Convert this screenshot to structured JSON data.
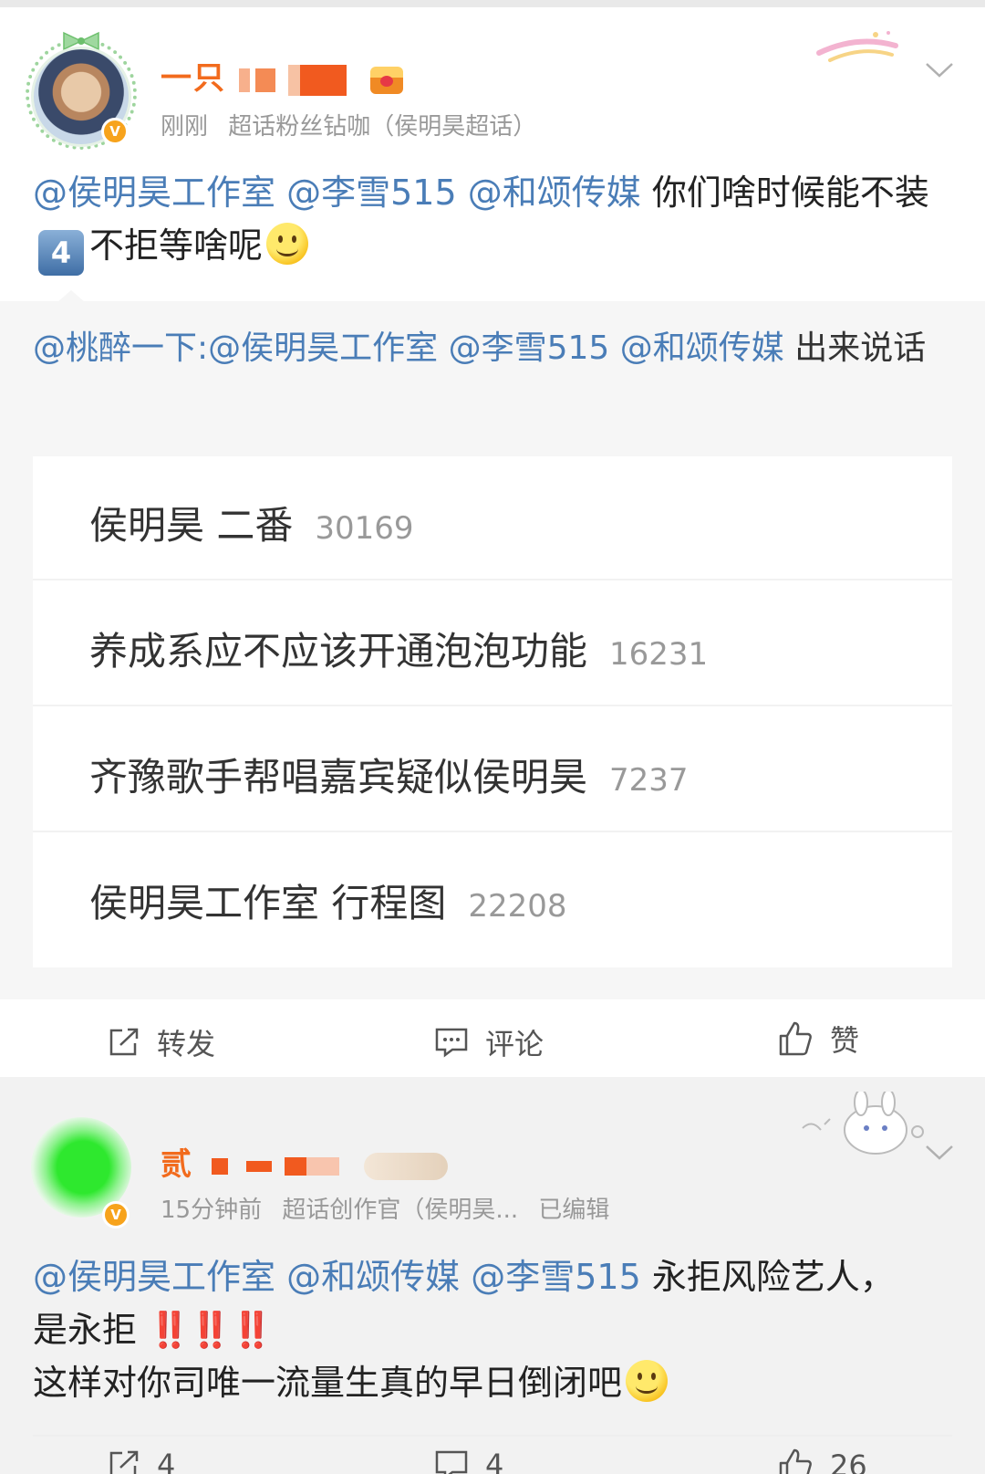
{
  "post1": {
    "username": "一只",
    "time": "刚刚",
    "source": "超话粉丝钻咖（侯明昊超话）",
    "mentions": [
      "@侯明昊工作室",
      "@李雪515",
      "@和颂传媒"
    ],
    "text_part1": "你们啥时候能不装",
    "keycap": "4",
    "text_part2": "不拒等啥呢",
    "retweet": {
      "author": "@桃醉一下:",
      "mentions": [
        "@侯明昊工作室",
        "@李雪515",
        "@和颂传媒"
      ],
      "text": "出来说话"
    },
    "topics": [
      {
        "title": "侯明昊 二番",
        "count": "30169"
      },
      {
        "title": "养成系应不应该开通泡泡功能",
        "count": "16231"
      },
      {
        "title": "齐豫歌手帮唱嘉宾疑似侯明昊",
        "count": "7237"
      },
      {
        "title": "侯明昊工作室 行程图",
        "count": "22208"
      }
    ],
    "actions": {
      "repost": "转发",
      "comment": "评论",
      "like": "赞"
    }
  },
  "post2": {
    "username": "贰",
    "time": "15分钟前",
    "source": "超话创作官（侯明昊...",
    "edited": "已编辑",
    "mentions": [
      "@侯明昊工作室",
      "@和颂传媒",
      "@李雪515"
    ],
    "text_part1": "永拒风险艺人，",
    "text_part2": "是永拒",
    "bangs": "‼️‼️‼️",
    "text_part3": "这样对你司唯一流量生真的早日倒闭吧",
    "actions": {
      "repost": "4",
      "comment": "4",
      "like": "26"
    }
  },
  "colors": {
    "accent": "#f26b1d",
    "mention": "#4a7db7",
    "muted": "#999999",
    "vip": "#f7a31c"
  },
  "icons": [
    "repost-icon",
    "comment-icon",
    "like-icon",
    "chevron-down-icon",
    "verified-icon",
    "smile-emoji-icon"
  ]
}
